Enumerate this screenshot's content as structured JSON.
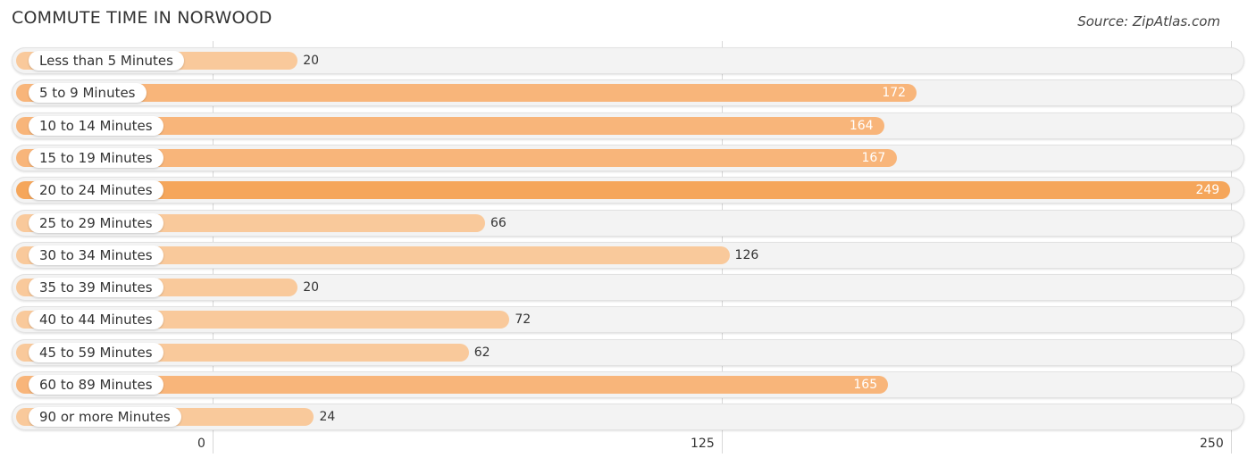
{
  "header": {
    "title": "COMMUTE TIME IN NORWOOD",
    "source": "Source: ZipAtlas.com"
  },
  "colors": {
    "bar_light": "#f9c99b",
    "bar_mid": "#f8b57a",
    "bar_max": "#f5a65b",
    "track": "#f3f3f3"
  },
  "chart_data": {
    "type": "bar",
    "orientation": "horizontal",
    "title": "COMMUTE TIME IN NORWOOD",
    "xlabel": "",
    "ylabel": "",
    "categories": [
      "Less than 5 Minutes",
      "5 to 9 Minutes",
      "10 to 14 Minutes",
      "15 to 19 Minutes",
      "20 to 24 Minutes",
      "25 to 29 Minutes",
      "30 to 34 Minutes",
      "35 to 39 Minutes",
      "40 to 44 Minutes",
      "45 to 59 Minutes",
      "60 to 89 Minutes",
      "90 or more Minutes"
    ],
    "values": [
      20,
      172,
      164,
      167,
      249,
      66,
      126,
      20,
      72,
      62,
      165,
      24
    ],
    "xlim": [
      0,
      250
    ],
    "xticks": [
      "0",
      "125",
      "250"
    ],
    "grid": true,
    "legend": "none"
  }
}
